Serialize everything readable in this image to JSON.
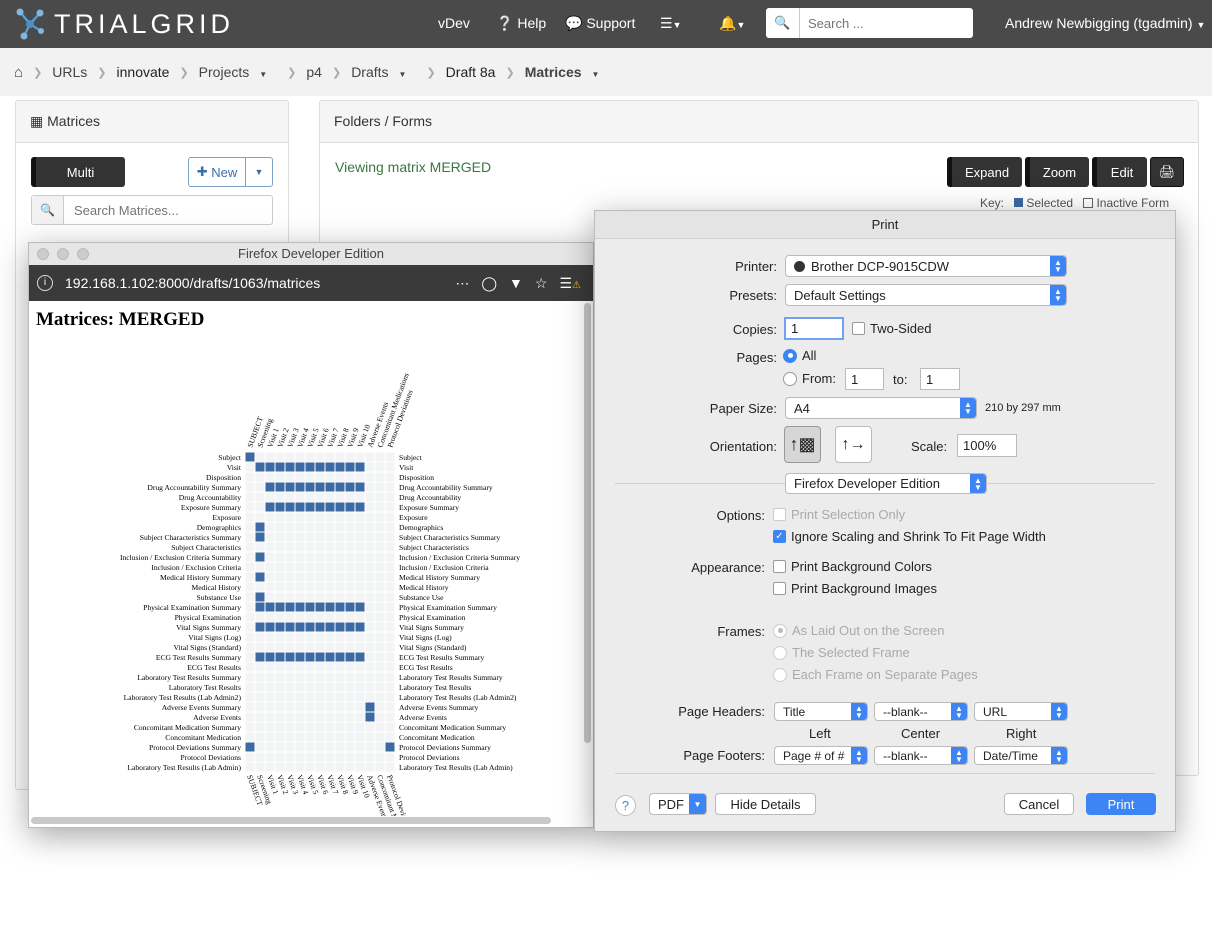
{
  "nav": {
    "brand": "TRIALGRID",
    "version": "vDev",
    "help": "Help",
    "support": "Support",
    "search_placeholder": "Search ...",
    "user": "Andrew Newbigging (tgadmin)"
  },
  "breadcrumb": [
    "URLs",
    "innovate",
    "Projects",
    "p4",
    "Drafts",
    "Draft 8a",
    "Matrices"
  ],
  "left_panel": {
    "title": "Matrices",
    "multi": "Multi",
    "new": "New",
    "search_placeholder": "Search Matrices..."
  },
  "right_panel": {
    "title": "Folders / Forms",
    "viewing": "Viewing matrix MERGED",
    "expand": "Expand",
    "zoom": "Zoom",
    "edit": "Edit",
    "key_label": "Key:",
    "key_selected": "Selected",
    "key_inactive": "Inactive Form"
  },
  "firefox": {
    "title": "Firefox Developer Edition",
    "url": "192.168.1.102:8000/drafts/1063/matrices",
    "page_title": "Matrices: MERGED"
  },
  "chart_data": {
    "type": "heatmap",
    "folders": [
      "SUBJECT",
      "Screening",
      "Visit 1",
      "Visit 2",
      "Visit 3",
      "Visit 4",
      "Visit 5",
      "Visit 6",
      "Visit 7",
      "Visit 8",
      "Visit 9",
      "Visit 10",
      "Adverse Events",
      "Concomitant Medications",
      "Protocol Deviations"
    ],
    "forms": [
      "Subject",
      "Visit",
      "Disposition",
      "Drug Accountability Summary",
      "Drug Accountability",
      "Exposure Summary",
      "Exposure",
      "Demographics",
      "Subject Characteristics Summary",
      "Subject Characteristics",
      "Inclusion / Exclusion Criteria Summary",
      "Inclusion / Exclusion Criteria",
      "Medical History Summary",
      "Medical History",
      "Substance Use",
      "Physical Examination Summary",
      "Physical Examination",
      "Vital Signs Summary",
      "Vital Signs (Log)",
      "Vital Signs (Standard)",
      "ECG Test Results Summary",
      "ECG Test Results",
      "Laboratory Test Results Summary",
      "Laboratory Test Results",
      "Laboratory Test Results (Lab Admin2)",
      "Adverse Events Summary",
      "Adverse Events",
      "Concomitant Medication Summary",
      "Concomitant Medication",
      "Protocol Deviations Summary",
      "Protocol Deviations",
      "Laboratory Test Results (Lab Admin)"
    ],
    "selected": [
      [
        0,
        0
      ],
      [
        1,
        1
      ],
      [
        1,
        2
      ],
      [
        1,
        3
      ],
      [
        1,
        4
      ],
      [
        1,
        5
      ],
      [
        1,
        6
      ],
      [
        1,
        7
      ],
      [
        1,
        8
      ],
      [
        1,
        9
      ],
      [
        1,
        10
      ],
      [
        1,
        11
      ],
      [
        3,
        2
      ],
      [
        3,
        3
      ],
      [
        3,
        4
      ],
      [
        3,
        5
      ],
      [
        3,
        6
      ],
      [
        3,
        7
      ],
      [
        3,
        8
      ],
      [
        3,
        9
      ],
      [
        3,
        10
      ],
      [
        3,
        11
      ],
      [
        5,
        2
      ],
      [
        5,
        3
      ],
      [
        5,
        4
      ],
      [
        5,
        5
      ],
      [
        5,
        6
      ],
      [
        5,
        7
      ],
      [
        5,
        8
      ],
      [
        5,
        9
      ],
      [
        5,
        10
      ],
      [
        5,
        11
      ],
      [
        7,
        1
      ],
      [
        8,
        1
      ],
      [
        10,
        1
      ],
      [
        12,
        1
      ],
      [
        14,
        1
      ],
      [
        15,
        1
      ],
      [
        15,
        2
      ],
      [
        15,
        3
      ],
      [
        15,
        4
      ],
      [
        15,
        5
      ],
      [
        15,
        6
      ],
      [
        15,
        7
      ],
      [
        15,
        8
      ],
      [
        15,
        9
      ],
      [
        15,
        10
      ],
      [
        15,
        11
      ],
      [
        17,
        1
      ],
      [
        17,
        2
      ],
      [
        17,
        3
      ],
      [
        17,
        4
      ],
      [
        17,
        5
      ],
      [
        17,
        6
      ],
      [
        17,
        7
      ],
      [
        17,
        8
      ],
      [
        17,
        9
      ],
      [
        17,
        10
      ],
      [
        17,
        11
      ],
      [
        20,
        1
      ],
      [
        20,
        2
      ],
      [
        20,
        3
      ],
      [
        20,
        4
      ],
      [
        20,
        5
      ],
      [
        20,
        6
      ],
      [
        20,
        7
      ],
      [
        20,
        8
      ],
      [
        20,
        9
      ],
      [
        20,
        10
      ],
      [
        20,
        11
      ],
      [
        25,
        12
      ],
      [
        26,
        12
      ],
      [
        29,
        0
      ],
      [
        29,
        14
      ]
    ],
    "selected_color": "#3c6aa3"
  },
  "print": {
    "title": "Print",
    "printer_label": "Printer:",
    "printer": "Brother DCP-9015CDW",
    "presets_label": "Presets:",
    "presets": "Default Settings",
    "copies_label": "Copies:",
    "copies": "1",
    "two_sided": "Two-Sided",
    "pages_label": "Pages:",
    "all": "All",
    "from": "From:",
    "from_val": "1",
    "to": "to:",
    "to_val": "1",
    "paper_label": "Paper Size:",
    "paper": "A4",
    "paper_dims": "210 by 297 mm",
    "orientation_label": "Orientation:",
    "scale_label": "Scale:",
    "scale": "100%",
    "app": "Firefox Developer Edition",
    "options_label": "Options:",
    "opt1": "Print Selection Only",
    "opt2": "Ignore Scaling and Shrink To Fit Page Width",
    "appearance_label": "Appearance:",
    "app1": "Print Background Colors",
    "app2": "Print Background Images",
    "frames_label": "Frames:",
    "fr1": "As Laid Out on the Screen",
    "fr2": "The Selected Frame",
    "fr3": "Each Frame on Separate Pages",
    "headers_label": "Page Headers:",
    "h_left": "Title",
    "h_center": "--blank--",
    "h_right": "URL",
    "col_left": "Left",
    "col_center": "Center",
    "col_right": "Right",
    "footers_label": "Page Footers:",
    "f_left": "Page # of #",
    "f_center": "--blank--",
    "f_right": "Date/Time",
    "help": "?",
    "pdf": "PDF",
    "hide_details": "Hide Details",
    "cancel": "Cancel",
    "print_btn": "Print"
  }
}
